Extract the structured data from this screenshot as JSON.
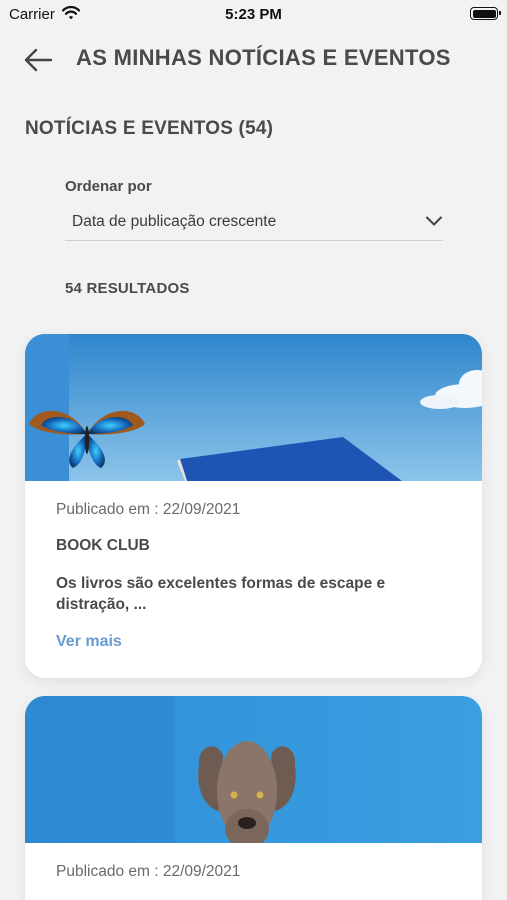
{
  "status": {
    "carrier": "Carrier",
    "time": "5:23 PM"
  },
  "header": {
    "title": "AS MINHAS NOTÍCIAS E EVENTOS",
    "back_icon": "arrow-left-icon"
  },
  "section": {
    "title": "NOTÍCIAS E EVENTOS (54)"
  },
  "sort": {
    "label": "Ordenar por",
    "value": "Data de publicação crescente"
  },
  "results": {
    "count_label": "54 RESULTADOS"
  },
  "cards": [
    {
      "published": "Publicado em : 22/09/2021",
      "title": "BOOK CLUB",
      "description": "Os livros são excelentes formas de escape e distração, ...",
      "link": "Ver mais",
      "image": "butterfly-book-sky-image"
    },
    {
      "published": "Publicado em : 22/09/2021",
      "image": "dog-blue-wall-image"
    }
  ],
  "colors": {
    "background": "#f2f2f2",
    "link": "#6a9bd0",
    "sky": "#3f97d8"
  }
}
